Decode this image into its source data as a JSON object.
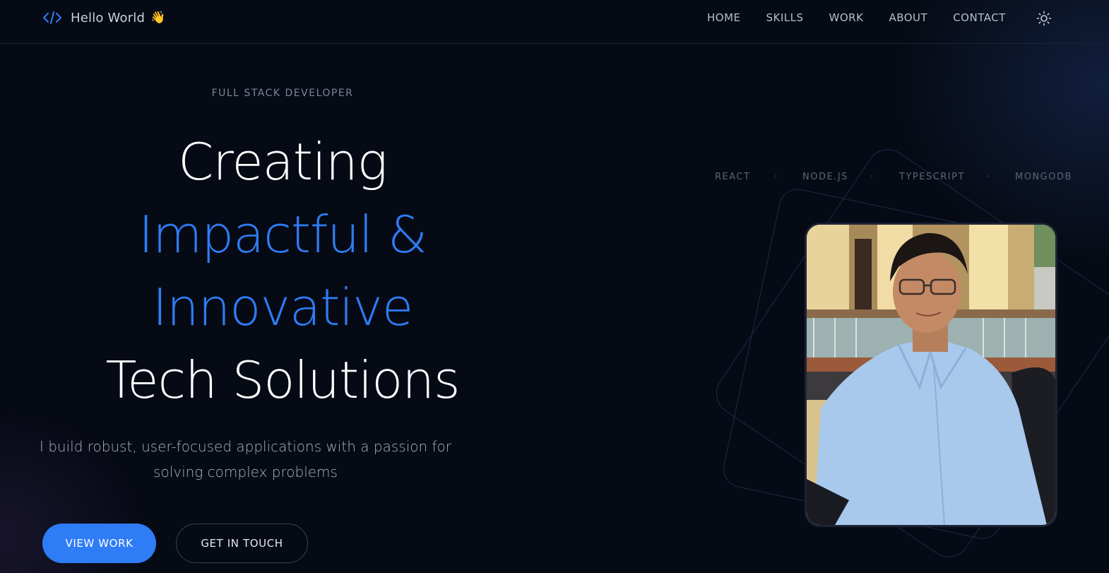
{
  "navbar": {
    "brand_text": "Hello World",
    "brand_icon": "code-icon",
    "wave_icon": "👋",
    "links": [
      "HOME",
      "SKILLS",
      "WORK",
      "ABOUT",
      "CONTACT"
    ],
    "theme_toggle_icon": "sun-icon"
  },
  "hero": {
    "eyebrow": "FULL STACK DEVELOPER",
    "headline": {
      "line1": "Creating",
      "line2": "Impactful &",
      "line3": "Innovative",
      "line4": "Tech Solutions"
    },
    "subtitle_line1": "I build robust, user-focused applications with a passion for",
    "subtitle_line2": "solving complex problems",
    "primary_button": "VIEW WORK",
    "secondary_button": "GET IN TOUCH"
  },
  "tech_stack": {
    "items": [
      "REACT",
      "NODE.JS",
      "TYPESCRIPT",
      "MONGODB"
    ],
    "separator": "·"
  },
  "portrait": {
    "description_icon": "profile-photo"
  },
  "colors": {
    "background": "#060a14",
    "accent": "#2e7cf6",
    "text": "#ffffff",
    "muted": "#7c8595"
  }
}
